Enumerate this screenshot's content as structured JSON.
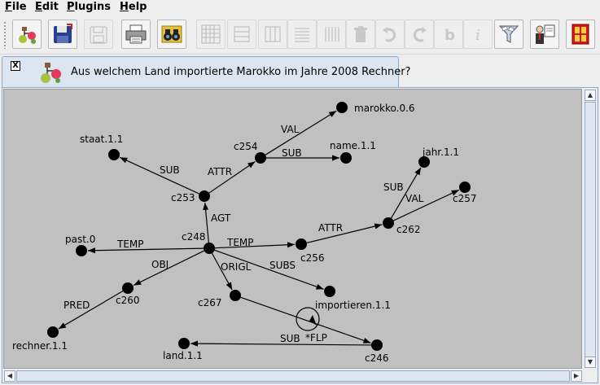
{
  "menu": [
    "File",
    "Edit",
    "Plugins",
    "Help"
  ],
  "menu_mnemonics": [
    "F",
    "E",
    "P",
    "H"
  ],
  "toolbar": {
    "buttons": [
      {
        "icon": "tree-new-icon",
        "enabled": true
      },
      {
        "icon": "save-icon",
        "enabled": true
      },
      {
        "icon": "save-disabled-icon",
        "enabled": false
      },
      {
        "icon": "print-icon",
        "enabled": true
      },
      {
        "icon": "binoculars-icon",
        "enabled": true
      },
      {
        "icon": "grid-icon",
        "enabled": false
      },
      {
        "icon": "align-horizontal-icon",
        "enabled": false
      },
      {
        "icon": "align-vertical-icon",
        "enabled": false
      },
      {
        "icon": "lines-horizontal-icon",
        "enabled": false
      },
      {
        "icon": "lines-vertical-icon",
        "enabled": false
      },
      {
        "icon": "trash-icon",
        "enabled": false
      },
      {
        "icon": "undo-icon",
        "enabled": false
      },
      {
        "icon": "redo-icon",
        "enabled": false
      },
      {
        "icon": "bold-b-icon",
        "enabled": false
      },
      {
        "icon": "info-i-icon",
        "enabled": false
      },
      {
        "icon": "funnel-filter-icon",
        "enabled": true
      },
      {
        "icon": "presenter-board-icon",
        "enabled": true
      },
      {
        "icon": "exit-door-icon",
        "enabled": true
      }
    ]
  },
  "tab": {
    "close_label": "X",
    "title": "Aus welchem Land importierte Marokko im Jahre 2008 Rechner?"
  },
  "graph": {
    "nodes": [
      {
        "id": "c248",
        "label": "c248"
      },
      {
        "id": "c253",
        "label": "c253"
      },
      {
        "id": "c254",
        "label": "c254"
      },
      {
        "id": "marokko",
        "label": "marokko.0.6"
      },
      {
        "id": "name",
        "label": "name.1.1"
      },
      {
        "id": "staat",
        "label": "staat.1.1"
      },
      {
        "id": "jahr",
        "label": "jahr.1.1"
      },
      {
        "id": "c262",
        "label": "c262"
      },
      {
        "id": "c257",
        "label": "c257"
      },
      {
        "id": "c256",
        "label": "c256"
      },
      {
        "id": "past",
        "label": "past.0"
      },
      {
        "id": "c260",
        "label": "c260"
      },
      {
        "id": "rechner",
        "label": "rechner.1.1"
      },
      {
        "id": "c267",
        "label": "c267"
      },
      {
        "id": "importieren",
        "label": "importieren.1.1"
      },
      {
        "id": "land",
        "label": "land.1.1"
      },
      {
        "id": "c246",
        "label": "c246"
      }
    ],
    "edges": [
      {
        "from": "c248",
        "to": "c253",
        "label": "AGT"
      },
      {
        "from": "c253",
        "to": "staat",
        "label": "SUB"
      },
      {
        "from": "c253",
        "to": "c254",
        "label": "ATTR"
      },
      {
        "from": "c254",
        "to": "marokko",
        "label": "VAL"
      },
      {
        "from": "c254",
        "to": "name",
        "label": "SUB"
      },
      {
        "from": "c248",
        "to": "past",
        "label": "TEMP"
      },
      {
        "from": "c248",
        "to": "c256",
        "label": "TEMP"
      },
      {
        "from": "c256",
        "to": "c262",
        "label": "ATTR"
      },
      {
        "from": "c262",
        "to": "jahr",
        "label": "SUB"
      },
      {
        "from": "c262",
        "to": "c257",
        "label": "VAL"
      },
      {
        "from": "c248",
        "to": "c260",
        "label": "OBJ"
      },
      {
        "from": "c260",
        "to": "rechner",
        "label": "PRED"
      },
      {
        "from": "c248",
        "to": "c267",
        "label": "ORIGL"
      },
      {
        "from": "c248",
        "to": "importieren",
        "label": "SUBS"
      },
      {
        "from": "c267",
        "to": "c246",
        "label": "*FLP"
      },
      {
        "from": "c246",
        "to": "land",
        "label": "SUB"
      }
    ]
  }
}
